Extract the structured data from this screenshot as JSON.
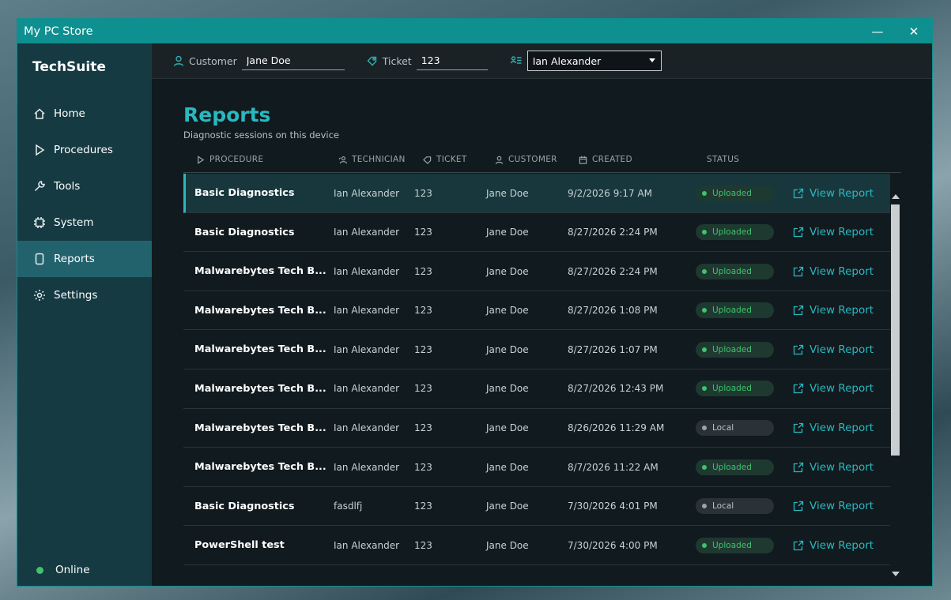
{
  "window": {
    "title": "My PC Store",
    "minimize": "—",
    "close": "✕"
  },
  "sidebar": {
    "brand": "TechSuite",
    "items": [
      {
        "label": "Home",
        "icon": "home-icon"
      },
      {
        "label": "Procedures",
        "icon": "play-icon"
      },
      {
        "label": "Tools",
        "icon": "wrench-icon"
      },
      {
        "label": "System",
        "icon": "chip-icon"
      },
      {
        "label": "Reports",
        "icon": "document-icon",
        "active": true
      },
      {
        "label": "Settings",
        "icon": "gear-icon"
      }
    ],
    "status": "Online"
  },
  "topbar": {
    "customer_label": "Customer",
    "customer_value": "Jane Doe",
    "ticket_label": "Ticket",
    "ticket_value": "123",
    "technician_value": "Ian Alexander"
  },
  "page": {
    "title": "Reports",
    "subtitle": "Diagnostic sessions on this device"
  },
  "table": {
    "headers": {
      "procedure": "PROCEDURE",
      "technician": "TECHNICIAN",
      "ticket": "TICKET",
      "customer": "CUSTOMER",
      "created": "CREATED",
      "status": "STATUS"
    },
    "view_label": "View Report",
    "rows": [
      {
        "procedure": "Basic Diagnostics",
        "technician": "Ian Alexander",
        "ticket": "123",
        "customer": "Jane Doe",
        "created": "9/2/2026 9:17 AM",
        "status": "Uploaded"
      },
      {
        "procedure": "Basic Diagnostics",
        "technician": "Ian Alexander",
        "ticket": "123",
        "customer": "Jane Doe",
        "created": "8/27/2026 2:24 PM",
        "status": "Uploaded"
      },
      {
        "procedure": "Malwarebytes Tech B...",
        "technician": "Ian Alexander",
        "ticket": "123",
        "customer": "Jane Doe",
        "created": "8/27/2026 2:24 PM",
        "status": "Uploaded"
      },
      {
        "procedure": "Malwarebytes Tech B...",
        "technician": "Ian Alexander",
        "ticket": "123",
        "customer": "Jane Doe",
        "created": "8/27/2026 1:08 PM",
        "status": "Uploaded"
      },
      {
        "procedure": "Malwarebytes Tech B...",
        "technician": "Ian Alexander",
        "ticket": "123",
        "customer": "Jane Doe",
        "created": "8/27/2026 1:07 PM",
        "status": "Uploaded"
      },
      {
        "procedure": "Malwarebytes Tech B...",
        "technician": "Ian Alexander",
        "ticket": "123",
        "customer": "Jane Doe",
        "created": "8/27/2026 12:43 PM",
        "status": "Uploaded"
      },
      {
        "procedure": "Malwarebytes Tech B...",
        "technician": "Ian Alexander",
        "ticket": "123",
        "customer": "Jane Doe",
        "created": "8/26/2026 11:29 AM",
        "status": "Local"
      },
      {
        "procedure": "Malwarebytes Tech B...",
        "technician": "Ian Alexander",
        "ticket": "123",
        "customer": "Jane Doe",
        "created": "8/7/2026 11:22 AM",
        "status": "Uploaded"
      },
      {
        "procedure": "Basic Diagnostics",
        "technician": "fasdlfj",
        "ticket": "123",
        "customer": "Jane Doe",
        "created": "7/30/2026 4:01 PM",
        "status": "Local"
      },
      {
        "procedure": "PowerShell test",
        "technician": "Ian Alexander",
        "ticket": "123",
        "customer": "Jane Doe",
        "created": "7/30/2026 4:00 PM",
        "status": "Uploaded"
      }
    ]
  },
  "colors": {
    "accent": "#2ab8c0",
    "titlebar": "#0f9090",
    "sidebar": "#153a42",
    "uploaded": "#3fc36e",
    "local": "#9aa6aa"
  }
}
